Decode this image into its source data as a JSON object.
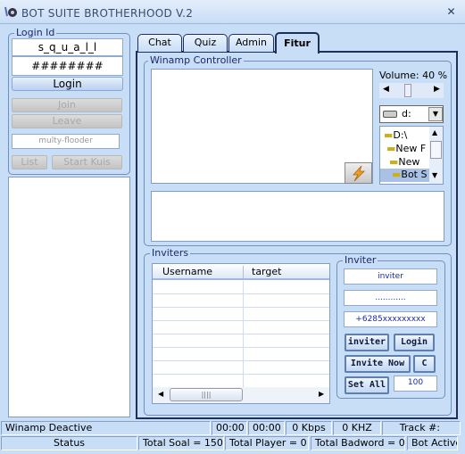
{
  "window": {
    "title": "BOT SUITE BROTHERHOOD V.2",
    "close": "✕"
  },
  "login": {
    "legend": "Login Id",
    "username": "s_q_u_a_l_l",
    "password": "########",
    "login_btn": "Login",
    "join_btn": "Join",
    "leave_btn": "Leave",
    "flooder": "multy-flooder",
    "list_btn": "List",
    "start_kuis_btn": "Start Kuis"
  },
  "tabs": [
    {
      "label": "Chat"
    },
    {
      "label": "Quiz"
    },
    {
      "label": "Admin"
    },
    {
      "label": "Fitur",
      "selected": true
    }
  ],
  "winamp": {
    "legend": "Winamp Controller",
    "volume_label": "Volume: 40 %",
    "volume": 40,
    "drive": "d:",
    "tree": [
      "D:\\",
      "New F",
      "New",
      "Bot S"
    ]
  },
  "inviters": {
    "legend": "Inviters",
    "columns": [
      "Username",
      "target"
    ],
    "rows": []
  },
  "inviter": {
    "legend": "Inviter",
    "user": "inviter",
    "pass": "............",
    "phone": "+6285xxxxxxxxx",
    "inviter_btn": "inviter",
    "login_btn": "Login",
    "invite_now_btn": "Invite Now",
    "c_btn": "C",
    "set_all_btn": "Set All",
    "count": "100"
  },
  "status1": [
    "Winamp Deactive",
    "00:00",
    "00:00",
    "0 Kbps",
    "0 KHZ",
    "Track #:"
  ],
  "status2": [
    "Status",
    "Total Soal = 150",
    "Total Player = 0",
    "Total Badword = 0",
    "Bot Active"
  ]
}
